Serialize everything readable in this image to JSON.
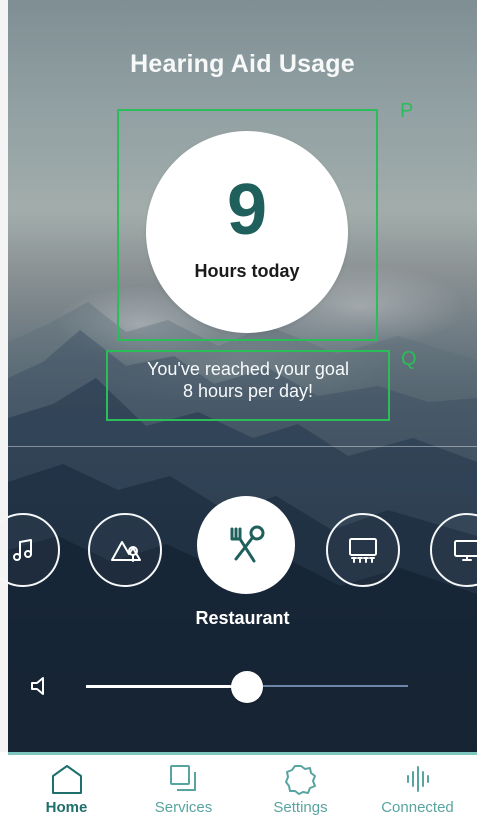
{
  "header": {
    "title": "Hearing Aid Usage"
  },
  "annotations": {
    "p": "P",
    "q": "Q"
  },
  "usage": {
    "hours": "9",
    "caption": "Hours today"
  },
  "goal": {
    "line1": "You've reached your goal",
    "line2": "8 hours per day!"
  },
  "program_selector": {
    "items": [
      {
        "icon": "music-note-icon"
      },
      {
        "icon": "outdoor-icon"
      },
      {
        "icon": "restaurant-icon"
      },
      {
        "icon": "theater-icon"
      },
      {
        "icon": "tv-icon"
      }
    ],
    "selected_label": "Restaurant"
  },
  "volume": {
    "icon": "speaker-icon",
    "level": 0.5
  },
  "colors": {
    "accent": "#1f5f5c",
    "nav_active": "#1f6f6c",
    "nav_inactive": "#58a4a0",
    "annotation": "#2bbd58"
  },
  "bottom_nav": {
    "items": [
      {
        "label": "Home",
        "icon": "home-icon",
        "active": true
      },
      {
        "label": "Services",
        "icon": "services-icon",
        "active": false
      },
      {
        "label": "Settings",
        "icon": "settings-icon",
        "active": false
      },
      {
        "label": "Connected",
        "icon": "connected-icon",
        "active": false
      }
    ]
  }
}
